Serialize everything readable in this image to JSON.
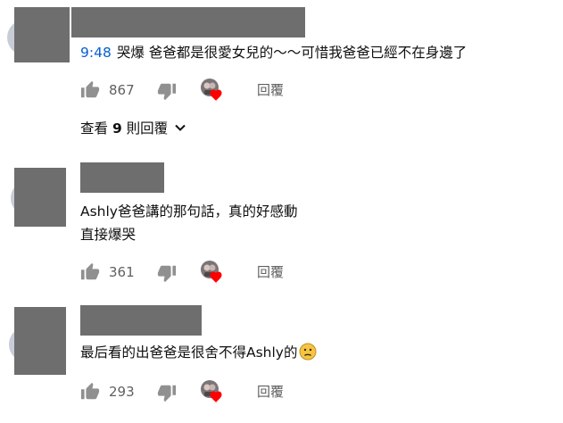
{
  "comments": [
    {
      "timestamp": "9:48",
      "lines": [
        "哭爆 爸爸都是很愛女兒的～～可惜我爸爸已經不在身邊了"
      ],
      "likes": "867",
      "reply_label": "回覆",
      "view_replies": {
        "prefix": "查看 ",
        "count": "9",
        "suffix": " 則回覆"
      }
    },
    {
      "lines": [
        "Ashly爸爸講的那句話，真的好感動",
        "直接爆哭"
      ],
      "likes": "361",
      "reply_label": "回覆"
    },
    {
      "lines": [
        "最后看的出爸爸是很舍不得Ashly的"
      ],
      "likes": "293",
      "reply_label": "回覆",
      "emoji": "sad-face-emoji"
    }
  ],
  "icons": {
    "like": "thumbs-up-icon",
    "dislike": "thumbs-down-icon",
    "hearted": "creator-heart-icon",
    "chevron": "chevron-down-icon"
  },
  "colors": {
    "timestamp_link": "#065fd4",
    "secondary_text": "#606060",
    "heart": "#ff0000",
    "redaction": "#6e6e6e"
  }
}
